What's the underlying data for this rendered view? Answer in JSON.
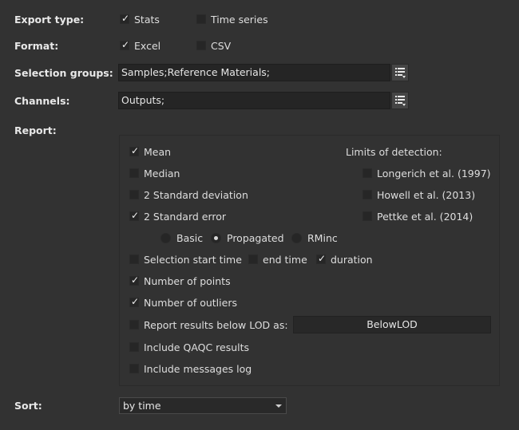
{
  "export_type": {
    "label": "Export type:",
    "options": [
      {
        "label": "Stats",
        "checked": true
      },
      {
        "label": "Time series",
        "checked": false
      }
    ]
  },
  "format": {
    "label": "Format:",
    "options": [
      {
        "label": "Excel",
        "checked": true
      },
      {
        "label": "CSV",
        "checked": false
      }
    ]
  },
  "selection_groups": {
    "label": "Selection groups:",
    "value": "Samples;Reference Materials;"
  },
  "channels": {
    "label": "Channels:",
    "value": "Outputs;"
  },
  "report": {
    "label": "Report:",
    "mean": {
      "label": "Mean",
      "checked": true
    },
    "median": {
      "label": "Median",
      "checked": false
    },
    "std_dev": {
      "label": "2 Standard deviation",
      "checked": false
    },
    "std_err": {
      "label": "2 Standard error",
      "checked": true
    },
    "error_mode": {
      "options": [
        "Basic",
        "Propagated",
        "RMinc"
      ],
      "selected": "Propagated"
    },
    "start_time": {
      "label": "Selection start time",
      "checked": false
    },
    "end_time": {
      "label": "end time",
      "checked": false
    },
    "duration": {
      "label": "duration",
      "checked": true
    },
    "num_points": {
      "label": "Number of points",
      "checked": true
    },
    "num_outliers": {
      "label": "Number of outliers",
      "checked": true
    },
    "below_lod": {
      "label": "Report results below LOD as:",
      "checked": false,
      "value": "BelowLOD"
    },
    "qaqc": {
      "label": "Include QAQC results",
      "checked": false
    },
    "messages": {
      "label": "Include messages log",
      "checked": false
    },
    "lod": {
      "title": "Limits of detection:",
      "options": [
        {
          "label": "Longerich et al. (1997)",
          "checked": false
        },
        {
          "label": "Howell et al. (2013)",
          "checked": false
        },
        {
          "label": "Pettke et al. (2014)",
          "checked": false
        }
      ]
    }
  },
  "sort": {
    "label": "Sort:",
    "value": "by time"
  },
  "icons": {
    "check": "checkmark-icon",
    "list": "list-icon",
    "dropdown": "chevron-down-icon"
  }
}
